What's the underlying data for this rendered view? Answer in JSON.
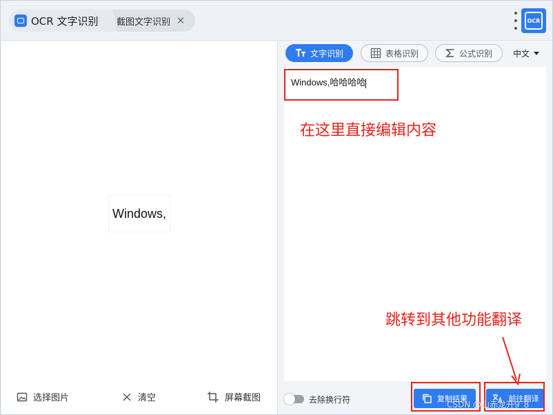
{
  "tabs": [
    {
      "label": "OCR 文字识别",
      "icon": "app-icon",
      "active": true
    },
    {
      "label": "截图文字识别",
      "icon": "close-icon",
      "active": false
    }
  ],
  "header": {
    "badge_text": "OCR",
    "menu_icon": "more-vertical-icon"
  },
  "left": {
    "preview_text": "Windows,",
    "toolbar": [
      {
        "label": "选择图片",
        "icon": "image-icon"
      },
      {
        "label": "清空",
        "icon": "close-icon"
      },
      {
        "label": "屏幕截图",
        "icon": "crop-icon"
      }
    ]
  },
  "right": {
    "modes": [
      {
        "label": "文字识别",
        "icon": "text-icon",
        "active": true
      },
      {
        "label": "表格识别",
        "icon": "table-icon",
        "active": false
      },
      {
        "label": "公式识别",
        "icon": "sigma-icon",
        "active": false
      }
    ],
    "language": "中文",
    "editor_text": "Windows,哈哈哈哈",
    "toggle_label": "去除换行符",
    "toggle_on": false,
    "copy_label": "复制结果",
    "translate_label": "前往翻译"
  },
  "annotations": {
    "edit_hint": "在这里直接编辑内容",
    "jump_hint": "跳转到其他功能翻译",
    "color": "#e5231b"
  },
  "watermark": "CSDN @山赤龙开9_8",
  "colors": {
    "accent": "#2f7bf0",
    "annotation": "#e5231b"
  }
}
